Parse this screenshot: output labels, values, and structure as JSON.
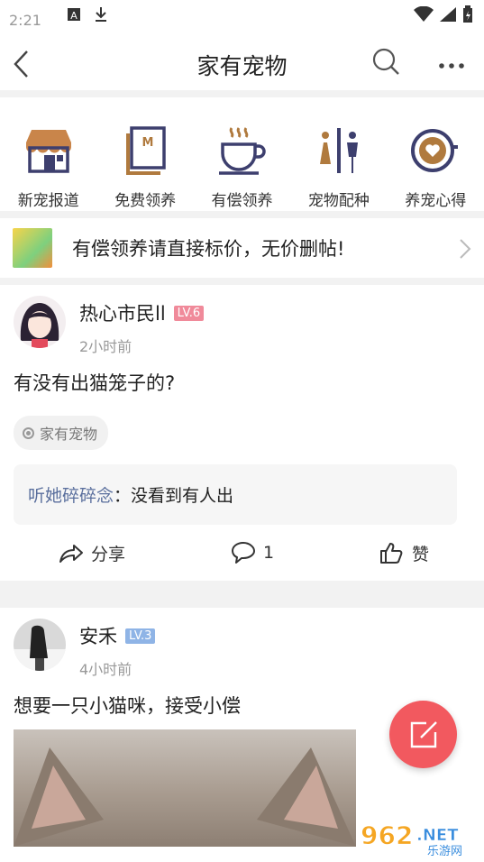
{
  "statusbar": {
    "time": "2:21"
  },
  "topbar": {
    "title": "家有宠物"
  },
  "categories": [
    {
      "label": "新宠报道",
      "icon": "shop-icon"
    },
    {
      "label": "免费领养",
      "icon": "book-icon"
    },
    {
      "label": "有偿领养",
      "icon": "coffee-cup-icon"
    },
    {
      "label": "宠物配种",
      "icon": "couple-icon"
    },
    {
      "label": "养宠心得",
      "icon": "heart-cup-icon"
    }
  ],
  "notice": {
    "text": "有偿领养请直接标价，无价删帖!"
  },
  "posts": [
    {
      "user": "热心市民ll",
      "level": "LV.6",
      "level_color": "#f08a9a",
      "time": "2小时前",
      "text": "有没有出猫笼子的?",
      "tag": "家有宠物",
      "comment_user": "听她碎碎念",
      "comment_sep": "：",
      "comment_text": "没看到有人出",
      "share_label": "分享",
      "comment_count": "1",
      "like_label": "赞"
    },
    {
      "user": "安禾",
      "level": "LV.3",
      "level_color": "#8fb4e6",
      "time": "4小时前",
      "text": "想要一只小猫咪，接受小偿"
    }
  ],
  "colors": {
    "icon_brown": "#b07a3e",
    "icon_navy": "#3d3f6e",
    "fab": "#f2595f"
  }
}
